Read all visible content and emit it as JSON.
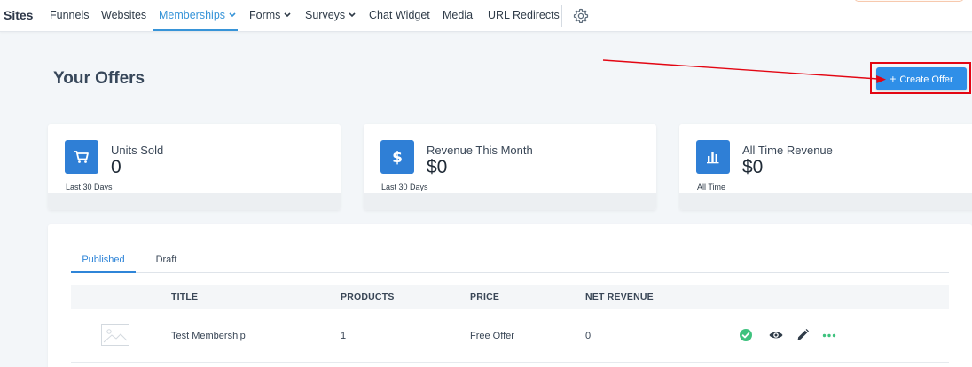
{
  "nav": {
    "brand": "Sites",
    "items": [
      {
        "label": "Funnels"
      },
      {
        "label": "Websites"
      },
      {
        "label": "Memberships",
        "active": true,
        "has_caret": true
      },
      {
        "label": "Forms",
        "has_caret": true
      },
      {
        "label": "Surveys",
        "has_caret": true
      },
      {
        "label": "Chat Widget"
      },
      {
        "label": "Media"
      },
      {
        "label": "URL Redirects"
      }
    ],
    "settings_icon": "gear-icon"
  },
  "page": {
    "title": "Your Offers",
    "create_button_label": "Create Offer",
    "create_button_icon": "plus-icon"
  },
  "stats": [
    {
      "label": "Units Sold",
      "value": "0",
      "sub": "Last 30 Days",
      "icon": "cart-icon"
    },
    {
      "label": "Revenue This Month",
      "value": "$0",
      "sub": "Last 30 Days",
      "icon": "dollar-icon"
    },
    {
      "label": "All Time Revenue",
      "value": "$0",
      "sub": "All Time",
      "icon": "bar-chart-icon"
    }
  ],
  "offers": {
    "tabs": [
      {
        "label": "Published",
        "active": true
      },
      {
        "label": "Draft"
      }
    ],
    "columns": [
      "TITLE",
      "PRODUCTS",
      "PRICE",
      "NET REVENUE"
    ],
    "rows": [
      {
        "title": "Test Membership",
        "products": "1",
        "price": "Free Offer",
        "net_revenue": "0",
        "thumbnail": "image-placeholder-icon",
        "status": "published"
      }
    ]
  },
  "colors": {
    "accent": "#2f8fe8",
    "icon_tile": "#2f7fd6",
    "active_tab": "#2f85d8",
    "status_ok": "#3ec27e",
    "annotation": "#e30613"
  }
}
